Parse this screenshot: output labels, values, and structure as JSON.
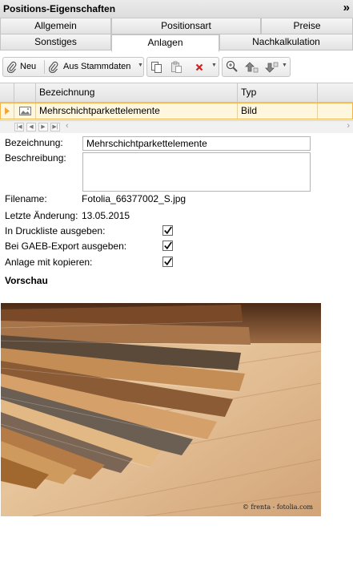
{
  "panel": {
    "title": "Positions-Eigenschaften",
    "collapse_glyph": "»"
  },
  "tabs": {
    "row1": [
      {
        "label": "Allgemein",
        "active": false
      },
      {
        "label": "Positionsart",
        "active": false
      },
      {
        "label": "Preise",
        "active": false
      }
    ],
    "row2": [
      {
        "label": "Sonstiges",
        "active": false
      },
      {
        "label": "Anlagen",
        "active": true
      },
      {
        "label": "Nachkalkulation",
        "active": false
      }
    ]
  },
  "toolbar": {
    "new_label": "Neu",
    "from_master_label": "Aus Stammdaten",
    "icons": [
      "paperclip-icon",
      "paperclip-icon",
      "copy-icon",
      "paste-icon",
      "delete-icon",
      "zoom-in-icon",
      "move-up-icon",
      "move-down-icon"
    ]
  },
  "grid": {
    "columns": [
      "Bezeichnung",
      "Typ"
    ],
    "rows": [
      {
        "bezeichnung": "Mehrschichtparkettelemente",
        "typ": "Bild",
        "icon": "image-icon",
        "selected": true
      }
    ],
    "pager_glyphs": {
      "first": "|◀",
      "prev": "◀",
      "next": "▶",
      "last": "▶|",
      "scroll_left": "‹",
      "scroll_right": "›"
    }
  },
  "form": {
    "bezeichnung_label": "Bezeichnung:",
    "bezeichnung_value": "Mehrschichtparkettelemente",
    "beschreibung_label": "Beschreibung:",
    "beschreibung_value": "",
    "filename_label": "Filename:",
    "filename_value": "Fotolia_66377002_S.jpg",
    "last_change_label": "Letzte Änderung:",
    "last_change_value": "13.05.2015",
    "print_list_label": "In Druckliste ausgeben:",
    "print_list_checked": true,
    "gaeb_label": "Bei GAEB-Export ausgeben:",
    "gaeb_checked": true,
    "copy_label": "Anlage mit kopieren:",
    "copy_checked": true
  },
  "preview": {
    "heading": "Vorschau",
    "credit": "© frenta - fotolia.com"
  },
  "colors": {
    "selected_row_bg": "#fff7dd",
    "selected_row_border": "#f2b34a",
    "delete_red": "#d42020"
  }
}
